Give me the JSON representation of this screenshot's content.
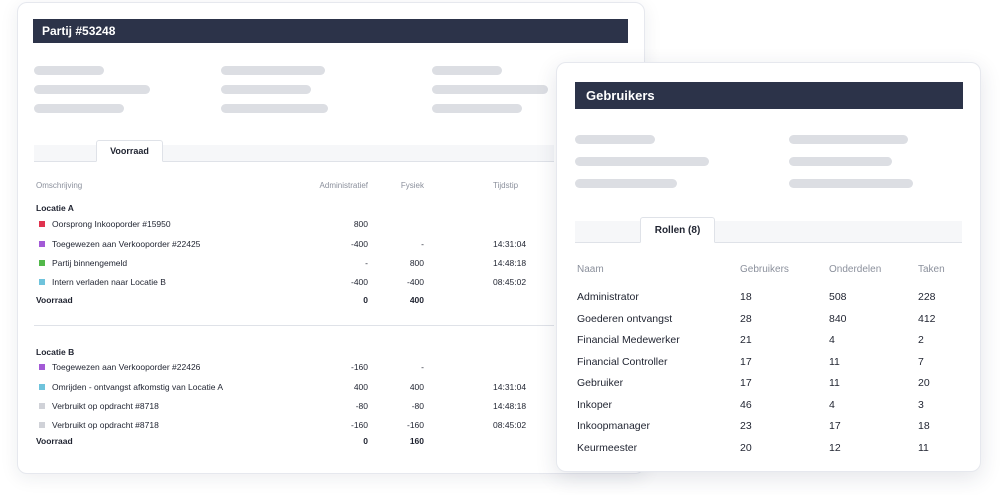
{
  "partij": {
    "title": "Partij #53248",
    "tab_label": "Voorraad",
    "columns": [
      "Omschrijving",
      "Administratief",
      "Fysiek",
      "Tijdstip"
    ],
    "sections": [
      {
        "label": "Locatie A",
        "rows": [
          {
            "desc": "Oorsprong Inkooporder #15950",
            "adm": "800",
            "fys": "",
            "tijd": "",
            "color": "#e0334f"
          },
          {
            "desc": "Toegewezen aan Verkooporder #22425",
            "adm": "-400",
            "fys": "-",
            "tijd": "14:31:04",
            "color": "#a35ad6"
          },
          {
            "desc": "Partij binnengemeld",
            "adm": "-",
            "fys": "800",
            "tijd": "14:48:18",
            "color": "#52b84a"
          },
          {
            "desc": "Intern verladen naar Locatie B",
            "adm": "-400",
            "fys": "-400",
            "tijd": "08:45:02",
            "color": "#6fc3dc"
          }
        ],
        "total": {
          "label": "Voorraad",
          "adm": "0",
          "fys": "400"
        }
      },
      {
        "label": "Locatie B",
        "rows": [
          {
            "desc": "Toegewezen aan Verkooporder #22426",
            "adm": "-160",
            "fys": "-",
            "tijd": "",
            "color": "#a35ad6"
          },
          {
            "desc": "Omrijden - ontvangst afkomstig van Locatie A",
            "adm": "400",
            "fys": "400",
            "tijd": "14:31:04",
            "color": "#6fc3dc"
          },
          {
            "desc": "Verbruikt op opdracht #8718",
            "adm": "-80",
            "fys": "-80",
            "tijd": "14:48:18",
            "color": "#d0d2d8"
          },
          {
            "desc": "Verbruikt op opdracht #8718",
            "adm": "-160",
            "fys": "-160",
            "tijd": "08:45:02",
            "color": "#d0d2d8"
          }
        ],
        "total": {
          "label": "Voorraad",
          "adm": "0",
          "fys": "160"
        }
      }
    ]
  },
  "gebruikers": {
    "title": "Gebruikers",
    "tab_label": "Rollen (8)",
    "columns": [
      "Naam",
      "Gebruikers",
      "Onderdelen",
      "Taken"
    ],
    "rows": [
      {
        "naam": "Administrator",
        "gebruikers": "18",
        "onderdelen": "508",
        "taken": "228"
      },
      {
        "naam": "Goederen ontvangst",
        "gebruikers": "28",
        "onderdelen": "840",
        "taken": "412"
      },
      {
        "naam": "Financial Medewerker",
        "gebruikers": "21",
        "onderdelen": "4",
        "taken": "2"
      },
      {
        "naam": "Financial Controller",
        "gebruikers": "17",
        "onderdelen": "11",
        "taken": "7"
      },
      {
        "naam": "Gebruiker",
        "gebruikers": "17",
        "onderdelen": "11",
        "taken": "20"
      },
      {
        "naam": "Inkoper",
        "gebruikers": "46",
        "onderdelen": "4",
        "taken": "3"
      },
      {
        "naam": "Inkoopmanager",
        "gebruikers": "23",
        "onderdelen": "17",
        "taken": "18"
      },
      {
        "naam": "Keurmeester",
        "gebruikers": "20",
        "onderdelen": "12",
        "taken": "11"
      }
    ]
  },
  "colors": {
    "header_bg": "#2c3349",
    "placeholder": "#dcdee3",
    "muted_text": "#8b909c"
  }
}
